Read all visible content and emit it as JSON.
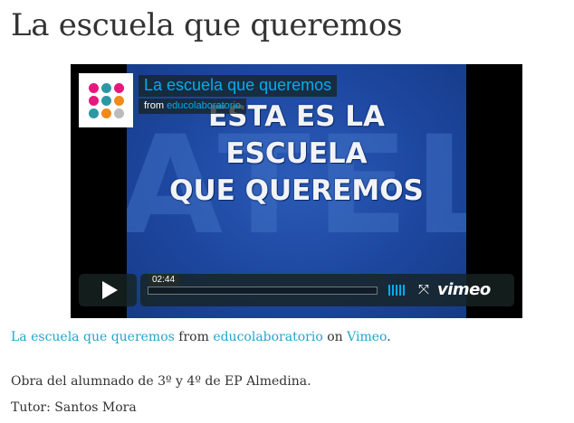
{
  "page": {
    "title": "La escuela que queremos"
  },
  "video": {
    "title": "La escuela que queremos",
    "byline_prefix": "from",
    "byline_user": "educolaboratorio",
    "slide_lines": [
      "ESTA ES LA",
      "ESCUELA",
      "QUE QUEREMOS"
    ],
    "background_letters": "ATELI",
    "duration": "02:44",
    "brand": "vimeo",
    "accent_color": "#00adef",
    "logo_dot_colors": [
      "#e5197d",
      "#2d97a3",
      "#e5197d",
      "#e5197d",
      "#2d97a3",
      "#f08a1d",
      "#2d97a3",
      "#f08a1d",
      "#bbbbbb"
    ],
    "icons": {
      "play": "play-icon",
      "volume": "volume-icon",
      "fullscreen": "fullscreen-icon"
    }
  },
  "credit": {
    "video_link": "La escuela que queremos",
    "from_word": "from",
    "user_link": "educolaboratorio",
    "on_word": "on",
    "site_link": "Vimeo",
    "end": "."
  },
  "description": {
    "line1": "Obra del alumnado de 3º y 4º de EP Almedina.",
    "line2": "Tutor: Santos Mora"
  }
}
